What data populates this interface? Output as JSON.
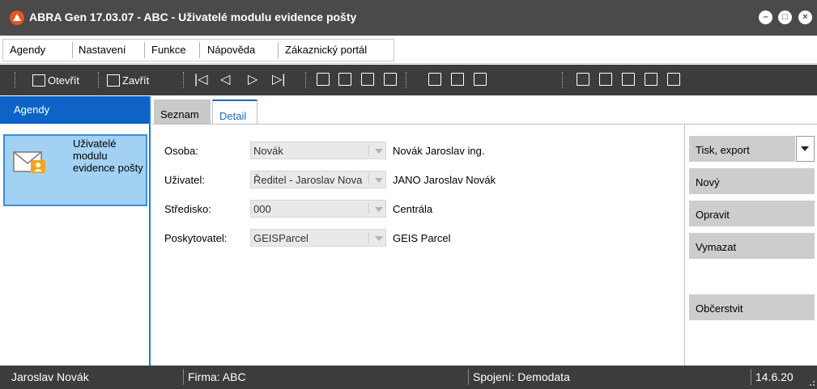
{
  "window": {
    "title": "ABRA Gen 17.03.07 - ABC - Uživatelé modulu evidence pošty"
  },
  "menu": {
    "items": [
      "Agendy",
      "Nastavení",
      "Funkce",
      "Nápověda",
      "Zákaznický portál"
    ]
  },
  "toolbar": {
    "open_label": "Otevřít",
    "close_label": "Zavřít"
  },
  "sidebar": {
    "header": "Agendy",
    "agenda_label": "Uživatelé modulu evidence pošty"
  },
  "tabs": {
    "list": "Seznam",
    "detail": "Detail"
  },
  "form": {
    "rows": [
      {
        "label": "Osoba:",
        "value": "Novák",
        "desc": "Novák Jaroslav ing."
      },
      {
        "label": "Uživatel:",
        "value": "Ředitel - Jaroslav Nova",
        "desc": "JANO Jaroslav Novák"
      },
      {
        "label": "Středisko:",
        "value": "000",
        "desc": "Centrála"
      },
      {
        "label": "Poskytovatel:",
        "value": "GEISParcel",
        "desc": "GEIS Parcel"
      }
    ]
  },
  "actions": {
    "print": "Tisk, export",
    "new": "Nový",
    "edit": "Opravit",
    "delete": "Vymazat",
    "refresh": "Občerstvit"
  },
  "status": {
    "user": "Jaroslav Novák",
    "company": "Firma: ABC",
    "connection": "Spojení: Demodata",
    "date": "14.6.20"
  },
  "colors": {
    "title_bar": "#4a4a4a",
    "toolbar": "#3c3c3c",
    "sidebar_header": "#0e63c7",
    "agenda_selected": "#a3d1f3",
    "active_tab": "#1b6dc1",
    "action_button": "#cdcdcd"
  }
}
